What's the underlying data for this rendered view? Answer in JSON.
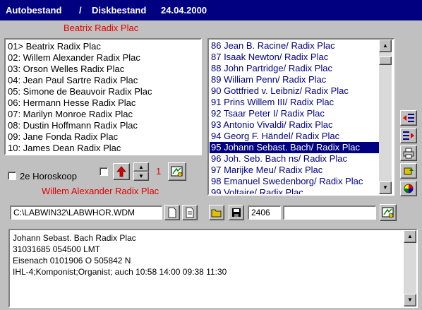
{
  "title": {
    "left": "Autobestand",
    "sep": "/",
    "right": "Diskbestand",
    "date": "24.04.2000"
  },
  "left_header": "Beatrix  Radix Plac",
  "left_list": [
    "01> Beatrix  Radix Plac",
    "02:  Willem Alexander Radix Plac",
    "03:  Orson Welles Radix Plac",
    "04:  Jean Paul Sartre Radix Plac",
    "05:  Simone de Beauvoir Radix Plac",
    "06:  Hermann Hesse Radix Plac",
    "07:  Marilyn Monroe Radix Plac",
    "08:  Dustin Hoffmann Radix Plac",
    "09:  Jane Fonda Radix Plac",
    "10:  James Dean Radix Plac"
  ],
  "right_list": [
    "86 Jean B. Racine/ Radix Plac",
    "87 Isaak Newton/ Radix Plac",
    "88 John Partridge/ Radix Plac",
    "89 William Penn/ Radix Plac",
    "90 Gottfried v. Leibniz/ Radix Plac",
    "91 Prins Willem III/ Radix Plac",
    "92 Tsaar Peter I/ Radix Plac",
    "93 Antonio Vivaldi/ Radix Plac",
    "94 Georg F. Händel/ Radix Plac",
    "95 Johann Sebast. Bach/ Radix Plac",
    "96 Joh. Seb. Bach ns/ Radix Plac",
    "97 Marijke Meu/ Radix Plac",
    "98 Emanuel Swedenborg/ Radix Plac",
    "99 Voltaire/ Radix Plac"
  ],
  "right_selected_index": 9,
  "second_horoscope_label": "2e Horoskoop",
  "counter_value": "1",
  "second_name": "Willem Alexander Radix Plac",
  "file_path": "C:\\LABWIN32\\LABWHOR.WDM",
  "record_number": "2406",
  "search_value": "",
  "memo": [
    "Johann Sebast. Bach Radix Plac",
    "31031685 054500 LMT",
    "Eisenach 0101906 O 505842 N",
    "IHL-4;Komponist;Organist; auch 10:58 14:00 09:38 11:30"
  ],
  "colors": {
    "title_bg": "#000080",
    "accent_red": "#e00000",
    "face": "#c0c0c0",
    "selection": "#000080"
  }
}
